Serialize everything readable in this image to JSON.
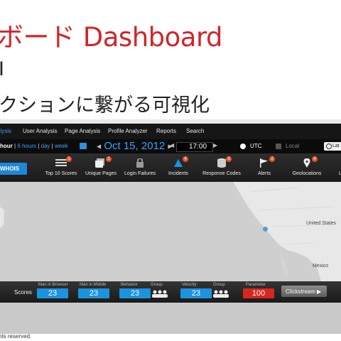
{
  "slide": {
    "title": "ボード Dashboard",
    "sub1": "I",
    "sub2": "クションに繋がる可視化",
    "footer": "hts reserved."
  },
  "nav": {
    "items": [
      "alysis",
      "User Analysis",
      "Page Analysis",
      "Profile Analyzer",
      "Reports",
      "Search"
    ],
    "active_index": 0
  },
  "timebar": {
    "range_hour": "hour",
    "range_6h": "6 hours",
    "range_day": "day",
    "range_week": "week",
    "date": "Oct 15, 2012",
    "time": "17:00",
    "utc": "UTC",
    "local": "Local",
    "latest": "Lat"
  },
  "toolbar": {
    "whois": "WHOIS",
    "tools": [
      {
        "label": "Top 10 Scores",
        "icon": "list-icon",
        "badge": "1"
      },
      {
        "label": "Unique Pages",
        "icon": "pages-icon",
        "badge": "1"
      },
      {
        "label": "Login Failures",
        "icon": "lock-icon",
        "badge": ""
      },
      {
        "label": "Incidents",
        "icon": "alarm-bell-icon",
        "badge": "4"
      },
      {
        "label": "Response Codes",
        "icon": "database-icon",
        "badge": "3"
      },
      {
        "label": "Alerts",
        "icon": "flag-icon",
        "badge": "2"
      },
      {
        "label": "Geolocations",
        "icon": "map-pin-icon",
        "badge": "4"
      },
      {
        "label": "L",
        "icon": "partial-icon",
        "badge": ""
      }
    ],
    "colors": {
      "accent": "#1a93e0",
      "badge": "#e8512a"
    }
  },
  "map": {
    "labels": {
      "us": "United States",
      "mexico": "Mexico"
    }
  },
  "scores": {
    "title": "Scores",
    "items": [
      {
        "label": "Man in Browser",
        "value": "23"
      },
      {
        "label": "Man in Middle",
        "value": "23"
      },
      {
        "label": "Behavior",
        "value": "23"
      },
      {
        "label": "Group",
        "value": ""
      },
      {
        "label": "Velocity",
        "value": "23"
      },
      {
        "label": "Group",
        "value": ""
      },
      {
        "label": "Parameter",
        "value": "100"
      }
    ],
    "clickstream": "Clickstream ▶"
  }
}
